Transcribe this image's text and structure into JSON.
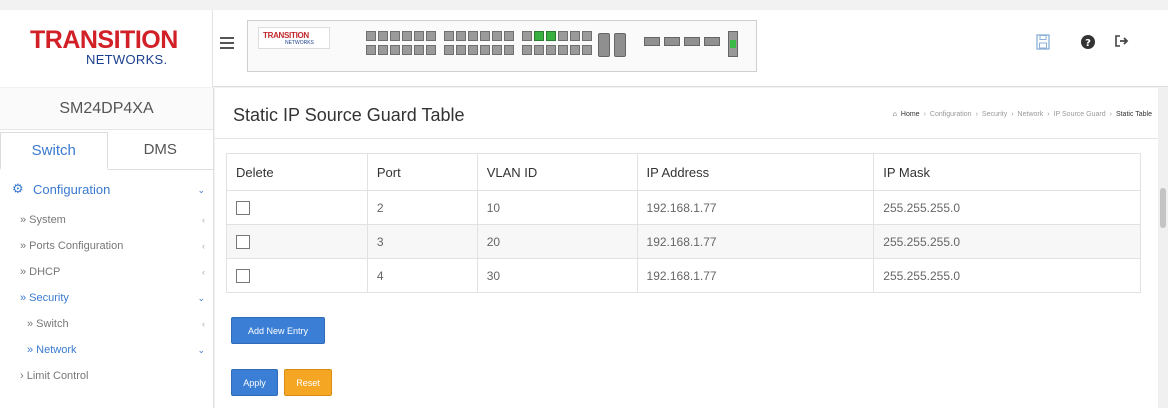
{
  "logo": {
    "main": "TRANSITION",
    "sub": "NETWORKS."
  },
  "device_logo": {
    "main": "TRANSITION",
    "sub": "NETWORKS"
  },
  "header_icons": [
    "save-icon",
    "help-icon",
    "logout-icon"
  ],
  "sidebar": {
    "model": "SM24DP4XA",
    "tabs": [
      {
        "label": "Switch",
        "active": true
      },
      {
        "label": "DMS",
        "active": false
      }
    ],
    "menu": [
      {
        "label": "Configuration",
        "level": 0,
        "arrow": "⌄",
        "highlight": true
      },
      {
        "label": "» System",
        "level": 1,
        "arrow": "‹",
        "highlight": false
      },
      {
        "label": "» Ports Configuration",
        "level": 1,
        "arrow": "‹",
        "highlight": false
      },
      {
        "label": "» DHCP",
        "level": 1,
        "arrow": "‹",
        "highlight": false
      },
      {
        "label": "» Security",
        "level": 1,
        "arrow": "⌄",
        "highlight": true
      },
      {
        "label": "» Switch",
        "level": 2,
        "arrow": "‹",
        "highlight": false
      },
      {
        "label": "» Network",
        "level": 2,
        "arrow": "⌄",
        "highlight": true
      },
      {
        "label": "› Limit Control",
        "level": 3,
        "arrow": "",
        "highlight": false
      }
    ]
  },
  "main": {
    "title": "Static IP Source Guard Table",
    "breadcrumb": [
      "Home",
      "Configuration",
      "Security",
      "Network",
      "IP Source Guard",
      "Static Table"
    ],
    "table": {
      "headers": [
        "Delete",
        "Port",
        "VLAN ID",
        "IP Address",
        "IP Mask"
      ],
      "rows": [
        {
          "delete": false,
          "port": "2",
          "vlan": "10",
          "ip": "192.168.1.77",
          "mask": "255.255.255.0"
        },
        {
          "delete": false,
          "port": "3",
          "vlan": "20",
          "ip": "192.168.1.77",
          "mask": "255.255.255.0"
        },
        {
          "delete": false,
          "port": "4",
          "vlan": "30",
          "ip": "192.168.1.77",
          "mask": "255.255.255.0"
        }
      ]
    },
    "buttons": {
      "add": "Add New Entry",
      "apply": "Apply",
      "reset": "Reset"
    }
  },
  "colors": {
    "brand_red": "#d22027",
    "brand_blue": "#1a3f8f",
    "accent_blue": "#3a7fd5",
    "reset_orange": "#f5a623",
    "link_active": "#3a7ad0",
    "port_up": "#38b040"
  }
}
